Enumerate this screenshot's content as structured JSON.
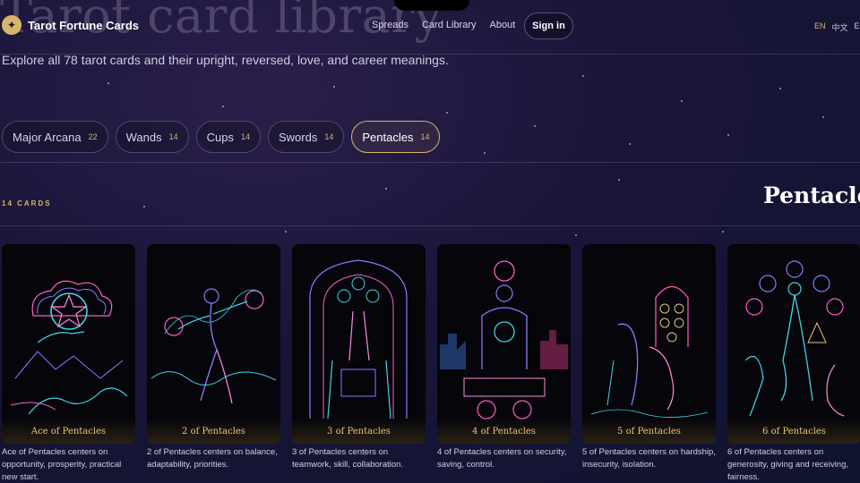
{
  "page": {
    "hero_title": "Tarot card library",
    "subtitle": "Explore all 78 tarot cards and their upright, reversed, love, and career meanings."
  },
  "header": {
    "logo_icon": "sparkle-icon",
    "logo_text": "Tarot Fortune Cards",
    "nav": [
      "Spreads",
      "Card Library",
      "About"
    ],
    "signin_label": "Sign in",
    "languages": [
      "EN",
      "中文",
      "ES"
    ],
    "active_language": "EN"
  },
  "suits": [
    {
      "label": "Major Arcana",
      "count": "22"
    },
    {
      "label": "Wands",
      "count": "14"
    },
    {
      "label": "Cups",
      "count": "14"
    },
    {
      "label": "Swords",
      "count": "14"
    },
    {
      "label": "Pentacles",
      "count": "14",
      "active": true
    }
  ],
  "section": {
    "count_label": "14 CARDS",
    "title": "Pentacles"
  },
  "cards": [
    {
      "name": "Ace of Pentacles",
      "description": "Ace of Pentacles centers on opportunity, prosperity, practical new start."
    },
    {
      "name": "2 of Pentacles",
      "description": "2 of Pentacles centers on balance, adaptability, priorities."
    },
    {
      "name": "3 of Pentacles",
      "description": "3 of Pentacles centers on teamwork, skill, collaboration."
    },
    {
      "name": "4 of Pentacles",
      "description": "4 of Pentacles centers on security, saving, control."
    },
    {
      "name": "5 of Pentacles",
      "description": "5 of Pentacles centers on hardship, insecurity, isolation."
    },
    {
      "name": "6 of Pentacles",
      "description": "6 of Pentacles centers on generosity, giving and receiving, fairness."
    }
  ],
  "colors": {
    "accent_gold": "#d8b56a",
    "background": "#1a1538",
    "neon_cyan": "#3fd6e8",
    "neon_pink": "#ff5fc8",
    "neon_violet": "#8a7bff"
  }
}
